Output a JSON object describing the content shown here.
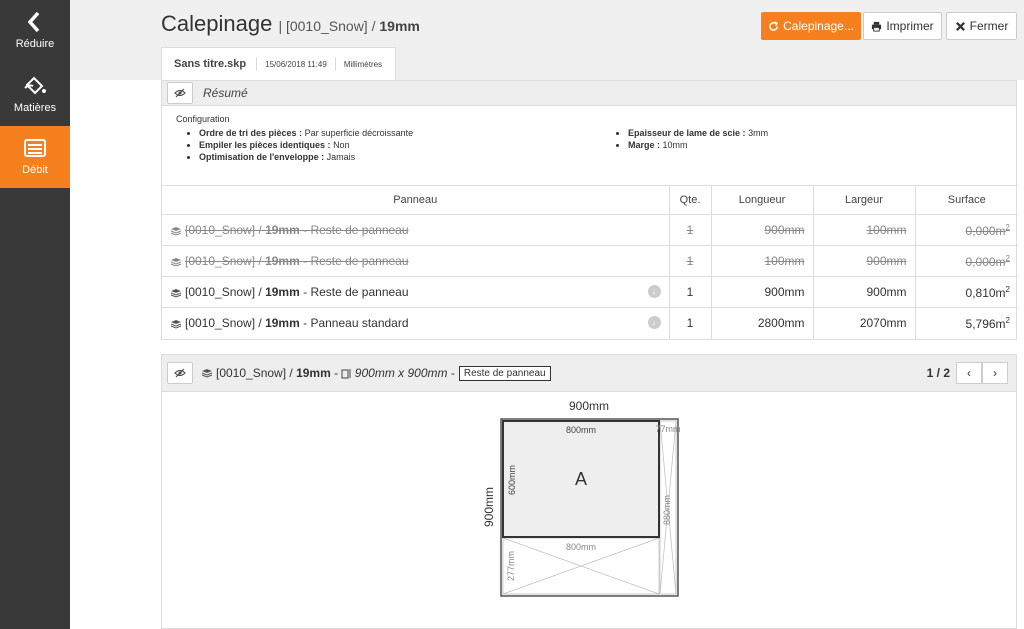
{
  "sidebar": {
    "items": [
      {
        "label": "Réduire",
        "icon": "chevron-left-icon"
      },
      {
        "label": "Matières",
        "icon": "paint-bucket-icon"
      },
      {
        "label": "Débit",
        "icon": "list-icon",
        "active": true
      }
    ]
  },
  "header": {
    "title": "Calepinage",
    "subtitle_prefix": "| [0010_Snow] /",
    "subtitle_bold": "19mm",
    "buttons": {
      "calepinage": "Calepinage...",
      "print": "Imprimer",
      "close": "Fermer"
    },
    "tab": {
      "name": "Sans titre.skp",
      "date": "15/06/2018 11:49",
      "unit": "Millimètres"
    }
  },
  "summary": {
    "title": "Résumé",
    "config_title": "Configuration",
    "left": [
      {
        "key": "Ordre de tri des pièces :",
        "value": "Par superficie décroissante"
      },
      {
        "key": "Empiler les pièces identiques :",
        "value": "Non"
      },
      {
        "key": "Optimisation de l'enveloppe :",
        "value": "Jamais"
      }
    ],
    "right": [
      {
        "key": "Epaisseur de lame de scie :",
        "value": "3mm"
      },
      {
        "key": "Marge :",
        "value": "10mm"
      }
    ]
  },
  "table": {
    "headers": [
      "Panneau",
      "Qte.",
      "Longueur",
      "Largeur",
      "Surface"
    ],
    "rows": [
      {
        "prefix": "[0010_Snow] /",
        "bold": "19mm",
        "suffix": "- Reste de panneau",
        "qty": "1",
        "length": "900mm",
        "width": "100mm",
        "surface": "0,000m",
        "struck": true
      },
      {
        "prefix": "[0010_Snow] /",
        "bold": "19mm",
        "suffix": "- Reste de panneau",
        "qty": "1",
        "length": "100mm",
        "width": "900mm",
        "surface": "0,000m",
        "struck": true
      },
      {
        "prefix": "[0010_Snow] /",
        "bold": "19mm",
        "suffix": "- Reste de panneau",
        "qty": "1",
        "length": "900mm",
        "width": "900mm",
        "surface": "0,810m",
        "struck": false
      },
      {
        "prefix": "[0010_Snow] /",
        "bold": "19mm",
        "suffix": "- Panneau standard",
        "qty": "1",
        "length": "2800mm",
        "width": "2070mm",
        "surface": "5,796m",
        "struck": false
      }
    ],
    "exponent": "2"
  },
  "sheet": {
    "prefix": "[0010_Snow] /",
    "bold": "19mm",
    "dash": "-",
    "dims": "900mm x 900mm",
    "tag": "Reste de panneau",
    "page": "1 / 2",
    "drawing": {
      "width_label": "900mm",
      "height_label": "900mm",
      "piece_label": "A",
      "piece_width": "800mm",
      "piece_height": "600mm",
      "offcut_right_w": "77mm",
      "offcut_right_h": "880mm",
      "offcut_bottom_w": "800mm",
      "offcut_bottom_h": "277mm"
    }
  },
  "colors": {
    "accent": "#f7801e",
    "sidebar": "#393939"
  }
}
